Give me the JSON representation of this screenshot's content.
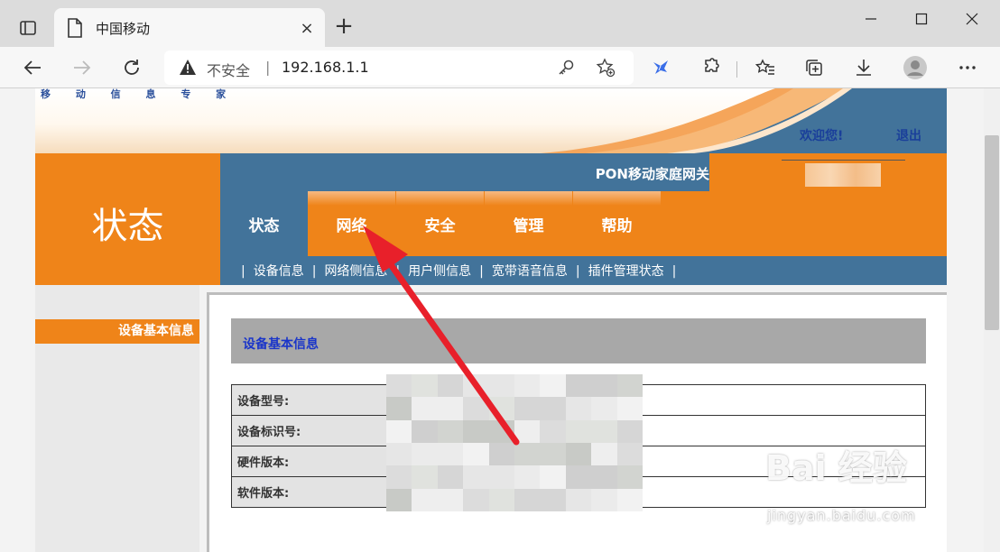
{
  "browser": {
    "tab_title": "中国移动",
    "close_tab": "×",
    "new_tab": "+",
    "security_label": "不安全",
    "separator": "|",
    "url": "192.168.1.1"
  },
  "banner": {
    "slogan": "移 动 信 息 专 家",
    "welcome": "欢迎您!",
    "logout": "退出"
  },
  "header": {
    "gateway_title": "PON移动家庭网关",
    "section_big": "状态"
  },
  "nav": {
    "items": [
      {
        "label": "状态",
        "active": true
      },
      {
        "label": "网络",
        "active": false
      },
      {
        "label": "安全",
        "active": false
      },
      {
        "label": "管理",
        "active": false
      },
      {
        "label": "帮助",
        "active": false
      }
    ]
  },
  "subnav": {
    "items": [
      "设备信息",
      "网络侧信息",
      "用户侧信息",
      "宽带语音信息",
      "插件管理状态"
    ]
  },
  "sidebar": {
    "active_item": "设备基本信息"
  },
  "content": {
    "section_title": "设备基本信息",
    "rows": [
      {
        "label": "设备型号:",
        "value": ""
      },
      {
        "label": "设备标识号:",
        "value": ""
      },
      {
        "label": "硬件版本:",
        "value": ""
      },
      {
        "label": "软件版本:",
        "value": ""
      }
    ]
  },
  "watermark": {
    "logo": "Bai 经验",
    "site": "jingyan.baidu.com"
  },
  "colors": {
    "orange": "#ef8419",
    "steel_blue": "#42739a",
    "link_blue": "#1a3f9a",
    "arrow_red": "#e8202a"
  }
}
